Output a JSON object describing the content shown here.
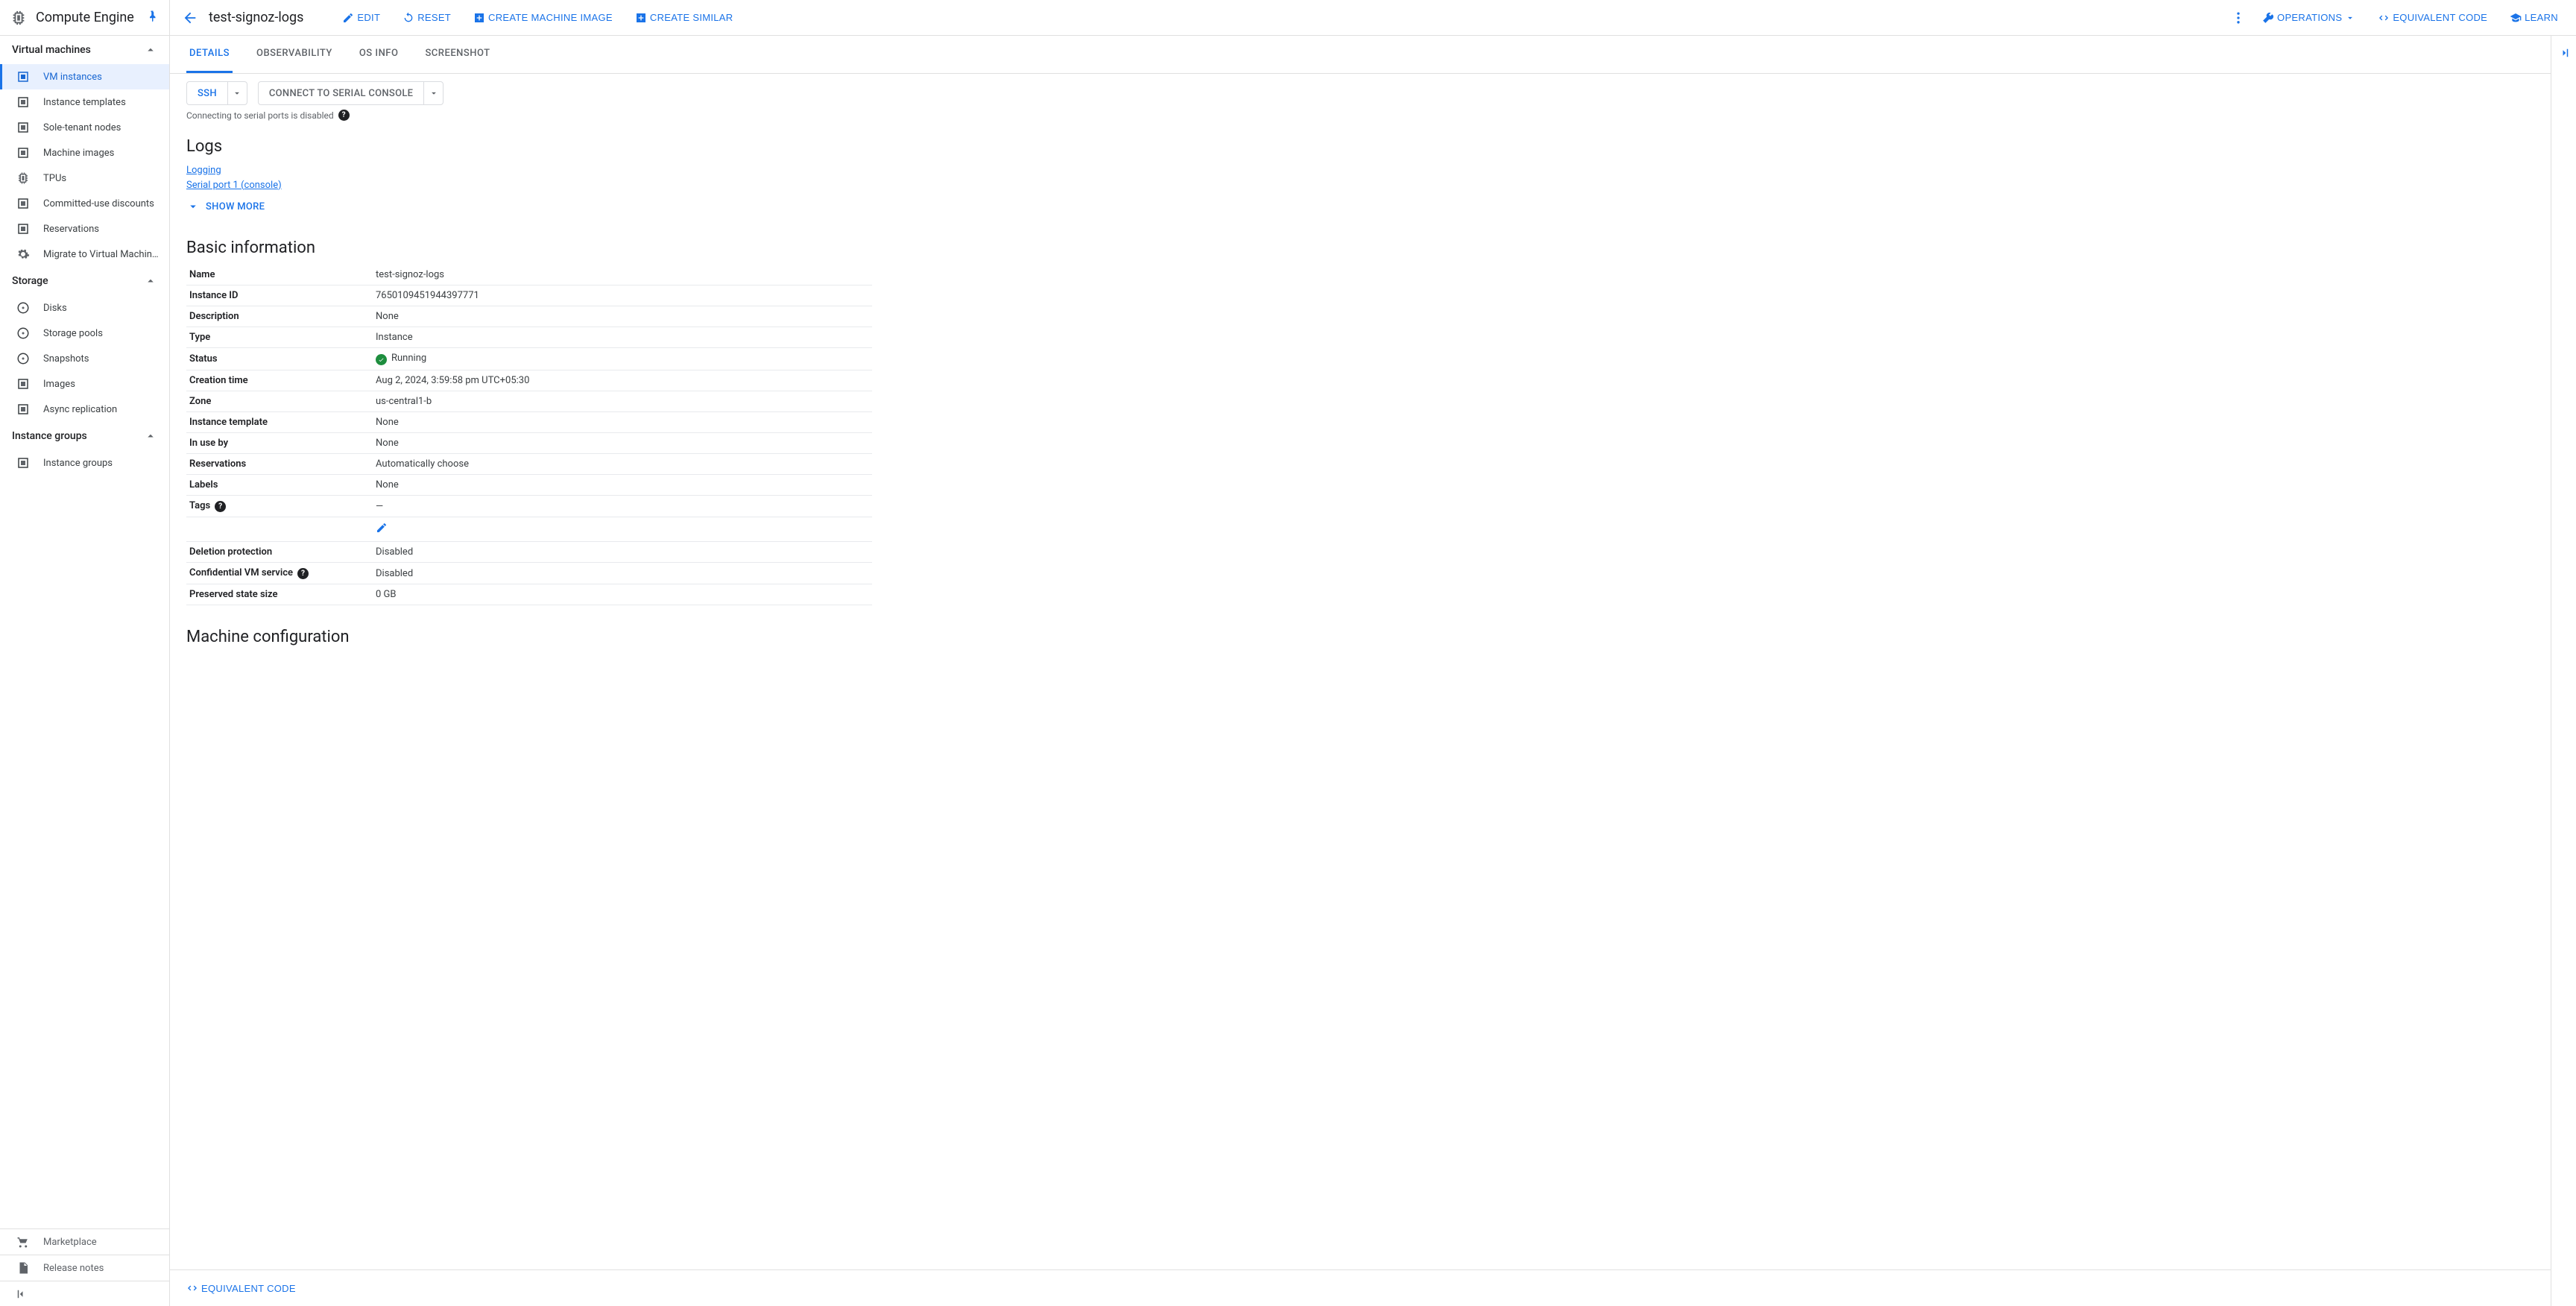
{
  "product": {
    "name": "Compute Engine"
  },
  "sidebar": {
    "sections": [
      {
        "label": "Virtual machines",
        "items": [
          {
            "label": "VM instances",
            "active": true
          },
          {
            "label": "Instance templates"
          },
          {
            "label": "Sole-tenant nodes"
          },
          {
            "label": "Machine images"
          },
          {
            "label": "TPUs"
          },
          {
            "label": "Committed-use discounts"
          },
          {
            "label": "Reservations"
          },
          {
            "label": "Migrate to Virtual Machin…"
          }
        ]
      },
      {
        "label": "Storage",
        "items": [
          {
            "label": "Disks"
          },
          {
            "label": "Storage pools"
          },
          {
            "label": "Snapshots"
          },
          {
            "label": "Images"
          },
          {
            "label": "Async replication"
          }
        ]
      },
      {
        "label": "Instance groups",
        "items": [
          {
            "label": "Instance groups"
          }
        ]
      }
    ],
    "footer": [
      {
        "label": "Marketplace"
      },
      {
        "label": "Release notes"
      }
    ]
  },
  "topbar": {
    "title": "test-signoz-logs",
    "actions": {
      "edit": "EDIT",
      "reset": "RESET",
      "create_image": "CREATE MACHINE IMAGE",
      "create_similar": "CREATE SIMILAR",
      "operations": "OPERATIONS",
      "equivalent_code": "EQUIVALENT CODE",
      "learn": "LEARN"
    }
  },
  "tabs": [
    "DETAILS",
    "OBSERVABILITY",
    "OS INFO",
    "SCREENSHOT"
  ],
  "ssh": {
    "ssh": "SSH",
    "serial": "CONNECT TO SERIAL CONSOLE",
    "note": "Connecting to serial ports is disabled"
  },
  "logs": {
    "heading": "Logs",
    "logging": "Logging",
    "serial_port": "Serial port 1 (console)",
    "show_more": "SHOW MORE"
  },
  "basic": {
    "heading": "Basic information",
    "rows": [
      {
        "k": "Name",
        "v": "test-signoz-logs"
      },
      {
        "k": "Instance ID",
        "v": "7650109451944397771"
      },
      {
        "k": "Description",
        "v": "None"
      },
      {
        "k": "Type",
        "v": "Instance"
      },
      {
        "k": "Status",
        "v": "Running",
        "status": true
      },
      {
        "k": "Creation time",
        "v": "Aug 2, 2024, 3:59:58 pm UTC+05:30"
      },
      {
        "k": "Zone",
        "v": "us-central1-b"
      },
      {
        "k": "Instance template",
        "v": "None"
      },
      {
        "k": "In use by",
        "v": "None"
      },
      {
        "k": "Reservations",
        "v": "Automatically choose"
      },
      {
        "k": "Labels",
        "v": "None"
      },
      {
        "k": "Tags",
        "v": "—",
        "help": true
      },
      {
        "k": "",
        "v": "",
        "pencil": true
      },
      {
        "k": "Deletion protection",
        "v": "Disabled"
      },
      {
        "k": "Confidential VM service",
        "v": "Disabled",
        "help": true
      },
      {
        "k": "Preserved state size",
        "v": "0 GB"
      }
    ]
  },
  "next_heading": "Machine configuration",
  "bottom": {
    "equivalent_code": "EQUIVALENT CODE"
  }
}
